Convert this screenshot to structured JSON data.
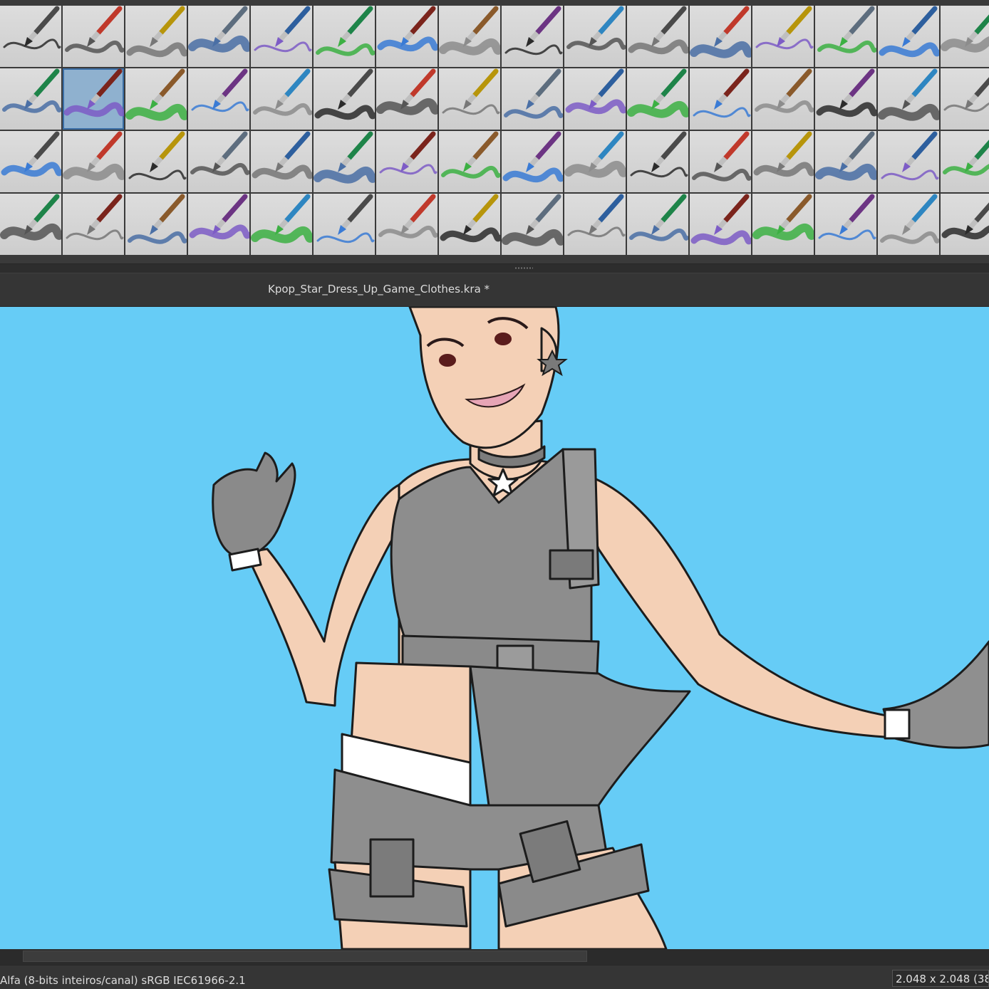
{
  "brush_presets": {
    "rows": [
      [
        "ink-pen-dark",
        "ink-brush-soft",
        "pencil-soft",
        "pencil-light",
        "pencil-hatching",
        "pencil-blue-scribble",
        "pen-fine-loop",
        "pencil-sketch-face",
        "pencil-graphite",
        "pen-fineliner-wave",
        "pencil-charcoal-wide",
        "charcoal-texture",
        "pen-crosshair",
        "pen-signature",
        "pen-thick-loop",
        "pen-thin-zigzag"
      ],
      [
        "brush-round-black",
        "eraser-block",
        "roller-smudge",
        "brush-calligraphy",
        "pen-nib-red",
        "brush-bristle-spatter",
        "brush-fan-dry",
        "brush-stroke-gray",
        "brush-flat-wash",
        "brush-texture-canvas",
        "crayon-green",
        "pastel-green",
        "pastel-ochre",
        "pastel-yellow",
        "pencil-red-curve",
        "pencil-black"
      ],
      [
        "rake-teal",
        "brush-flat-hatch",
        "brush-wet-purple",
        "brush-wet-fan-purple",
        "marker-wet-violet",
        "palette-knife-purple",
        "brush-wet-violet",
        "brush-wet-lilac",
        "brush-wet-dark",
        "brush-wet-blend",
        "brush-green-paint",
        "watercolor-blue-line",
        "watercolor-blue-zigzag",
        "watercolor-blue-loop",
        "watercolor-blue-stroke",
        "watercolor-blue-wide"
      ],
      [
        "watercolor-green-1",
        "watercolor-green-2",
        "eraser-white-round",
        "eraser-white-soft",
        "knife-blend-white",
        "pixel-blocks",
        "knife-blend-pattern",
        "smudge-white",
        "brush-wet-cyan",
        "rainbow-filter",
        "star-sparkle",
        "light-blur",
        "tube-dark",
        "airbrush-red",
        "airbrush-yellow",
        "rgb-texture"
      ]
    ],
    "selected_index": 17
  },
  "document": {
    "tab_title": "Kpop_Star_Dress_Up_Game_Clothes.kra *"
  },
  "status": {
    "color_space": "Alfa (8-bits inteiros/canal)  sRGB IEC61966-2.1",
    "image_size": "2.048 x 2.048 (38"
  },
  "colors": {
    "canvas_background": "#66ccf6",
    "skin": "#f5d2b8",
    "outfit_gray": "#8a8a8a",
    "selection_highlight": "#8fb1cf"
  }
}
